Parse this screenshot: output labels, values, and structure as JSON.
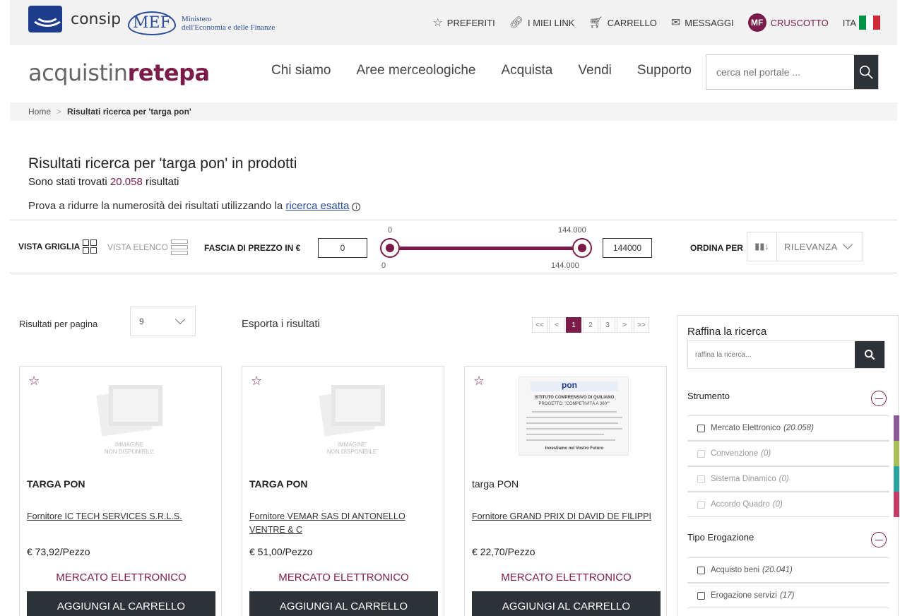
{
  "topbar": {
    "consip": "consip",
    "mef": "MEF",
    "mef_line1": "Ministero",
    "mef_line2": "dell'Economia e delle Finanze",
    "links": {
      "preferiti": "PREFERITI",
      "link": "I MIEI LINK",
      "carrello": "CARRELLO",
      "messaggi": "MESSAGGI",
      "badge": "MF",
      "cruscotto": "CRUSCOTTO",
      "lang": "ITA"
    },
    "flag_colors": [
      "#009246",
      "#ffffff",
      "#ce2b37"
    ]
  },
  "header": {
    "brand_a": "acquistin",
    "brand_b": "rete",
    "brand_c": "pa",
    "nav": [
      "Chi siamo",
      "Aree merceologiche",
      "Acquista",
      "Vendi",
      "Supporto"
    ],
    "search_placeholder": "cerca nel portale ..."
  },
  "breadcrumb": {
    "home": "Home",
    "current": "Risultati ricerca per 'targa pon'"
  },
  "results": {
    "title": "Risultati ricerca per 'targa pon' in prodotti",
    "count_pre": "Sono stati trovati ",
    "count_num": "20.058",
    "count_post": " risultati",
    "hint_pre": "Prova a ridurre la numerosità dei risultati utilizzando la ",
    "hint_link": "ricerca esatta"
  },
  "toolbar": {
    "vista_griglia": "VISTA GRIGLIA",
    "vista_elenco": "VISTA ELENCO",
    "price_label": "FASCIA DI PREZZO IN €",
    "price_min": "0",
    "price_max": "144000",
    "slider_min_top": "0",
    "slider_max_top": "144.000",
    "slider_min_bottom": "0",
    "slider_max_bottom": "144.000",
    "sort_label": "ORDINA PER",
    "sort_value": "RILEVANZA"
  },
  "controls": {
    "rpp_label": "Risultati per pagina",
    "rpp_value": "9",
    "export": "Esporta i risultati",
    "pager": [
      "<<",
      "<",
      "1",
      "2",
      "3",
      ">",
      ">>"
    ]
  },
  "cards": [
    {
      "name": "TARGA PON",
      "supplier": "Fornitore IC TECH SERVICES S.R.L.S.",
      "price": "€ 73,92/Pezzo",
      "tipo": "MERCATO ELETTRONICO",
      "add": "AGGIUNGI AL CARRELLO",
      "noimg1": "IMMAGINE",
      "noimg2": "NON DISPONIBILE"
    },
    {
      "name": "TARGA PON",
      "supplier": "Fornitore VEMAR SAS DI ANTONELLO VENTRE & C",
      "price": "€ 51,00/Pezzo",
      "tipo": "MERCATO ELETTRONICO",
      "add": "AGGIUNGI AL CARRELLO",
      "noimg1": "IMMAGINE",
      "noimg2": "NON DISPONIBILE"
    },
    {
      "name": "targa PON",
      "supplier": "Fornitore GRAND PRIX DI DAVID DE FILIPPI",
      "price": "€ 22,70/Pezzo",
      "tipo": "MERCATO ELETTRONICO",
      "add": "AGGIUNGI AL CARRELLO",
      "poster_logo": "pon",
      "poster_title": "ISTITUTO COMPRENSIVO DI QUILIANO",
      "poster_sub": "PROGETTO: \"COMPETIVITÀ A 360°\"",
      "poster_foot": "Investiamo nel Vostro Futuro"
    }
  ],
  "sidebar": {
    "title": "Raffina la ricerca",
    "placeholder": "raffina la ricerca...",
    "strumento": "Strumento",
    "strumento_items": [
      {
        "label": "Mercato Elettronico",
        "count": "(20.058)",
        "color": "#8e5a9c"
      },
      {
        "label": "Convenzione",
        "count": "(0)",
        "color": "#a6bd58"
      },
      {
        "label": "Sistema Dinamico",
        "count": "(0)",
        "color": "#2aa4a1"
      },
      {
        "label": "Accordo Quadro",
        "count": "(0)",
        "color": "#c83a66"
      }
    ],
    "tipo": "Tipo Erogazione",
    "tipo_items": [
      {
        "label": "Acquisto beni",
        "count": "(20.041)"
      },
      {
        "label": "Erogazione servizi",
        "count": "(17)"
      }
    ]
  },
  "colors": {
    "accent": "#7b1b49",
    "dark": "#2d3138"
  }
}
